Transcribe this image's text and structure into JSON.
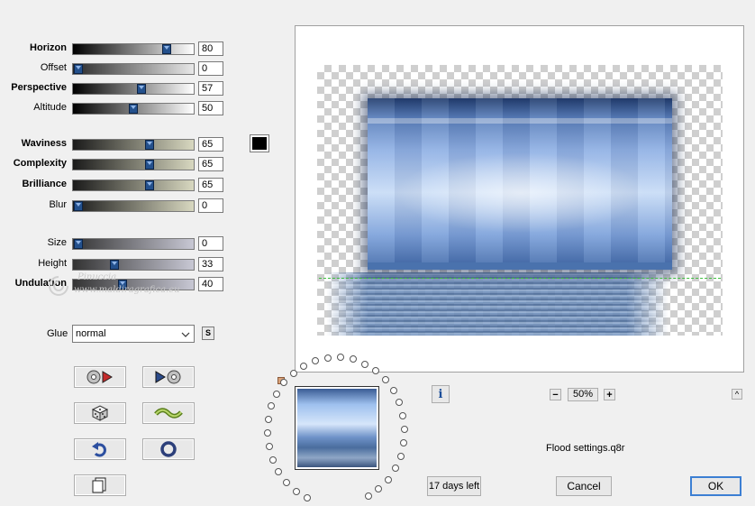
{
  "sliders": [
    {
      "label": "Horizon",
      "value": "80",
      "fraction": 0.8
    },
    {
      "label": "Offset",
      "value": "0",
      "fraction": 0.0
    },
    {
      "label": "Perspective",
      "value": "57",
      "fraction": 0.57
    },
    {
      "label": "Altitude",
      "value": "50",
      "fraction": 0.5
    },
    {
      "label": "Waviness",
      "value": "65",
      "fraction": 0.65
    },
    {
      "label": "Complexity",
      "value": "65",
      "fraction": 0.65
    },
    {
      "label": "Brilliance",
      "value": "65",
      "fraction": 0.65
    },
    {
      "label": "Blur",
      "value": "0",
      "fraction": 0.0
    },
    {
      "label": "Size",
      "value": "0",
      "fraction": 0.0
    },
    {
      "label": "Height",
      "value": "33",
      "fraction": 0.33
    },
    {
      "label": "Undulation",
      "value": "40",
      "fraction": 0.4
    }
  ],
  "color_swatch": "#000000",
  "glue": {
    "label": "Glue",
    "value": "normal",
    "lock_label": "S"
  },
  "watermark": {
    "name": "Pinuccia",
    "url": "www.maldiragrafica.eu"
  },
  "preview": {
    "zoom": "50%",
    "zoom_minus": "−",
    "zoom_plus": "+"
  },
  "info_label": "i",
  "collapse_label": "^",
  "settings_file": "Flood settings.q8r",
  "trial": "17 days left",
  "cancel_label": "Cancel",
  "ok_label": "OK"
}
